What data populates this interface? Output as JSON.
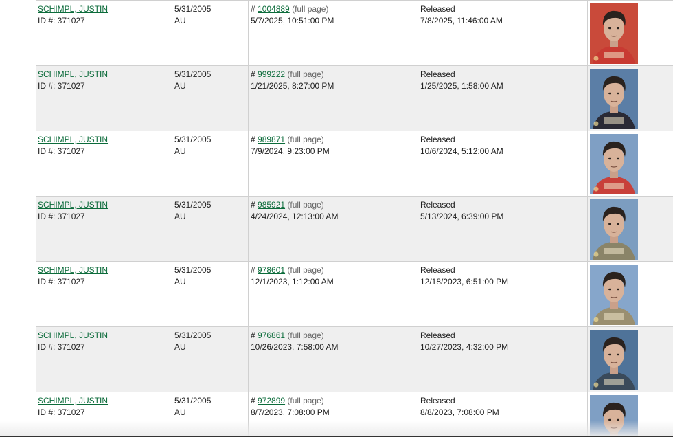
{
  "records": [
    {
      "name": "SCHIMPL, JUSTIN",
      "id_line": "ID #: 371027",
      "dob": "5/31/2005",
      "race_sex": "AU",
      "booking_prefix": "# ",
      "booking_number": "1004889",
      "full_page": "(full page)",
      "booking_date": "5/7/2025, 10:51:00 PM",
      "status": "Released",
      "release_date": "7/8/2025, 11:46:00 AM",
      "photo_bg": "#c94a3a",
      "photo_shirt": "#c83a32"
    },
    {
      "name": "SCHIMPL, JUSTIN",
      "id_line": "ID #: 371027",
      "dob": "5/31/2005",
      "race_sex": "AU",
      "booking_prefix": "# ",
      "booking_number": "999222",
      "full_page": "(full page)",
      "booking_date": "1/21/2025, 8:27:00 PM",
      "status": "Released",
      "release_date": "1/25/2025, 1:58:00 AM",
      "photo_bg": "#5b7ea6",
      "photo_shirt": "#2a2a35"
    },
    {
      "name": "SCHIMPL, JUSTIN",
      "id_line": "ID #: 371027",
      "dob": "5/31/2005",
      "race_sex": "AU",
      "booking_prefix": "# ",
      "booking_number": "989871",
      "full_page": "(full page)",
      "booking_date": "7/9/2024, 9:23:00 PM",
      "status": "Released",
      "release_date": "10/6/2024, 5:12:00 AM",
      "photo_bg": "#7f9fc4",
      "photo_shirt": "#c8403a"
    },
    {
      "name": "SCHIMPL, JUSTIN",
      "id_line": "ID #: 371027",
      "dob": "5/31/2005",
      "race_sex": "AU",
      "booking_prefix": "# ",
      "booking_number": "985921",
      "full_page": "(full page)",
      "booking_date": "4/24/2024, 12:13:00 AM",
      "status": "Released",
      "release_date": "5/13/2024, 6:39:00 PM",
      "photo_bg": "#7c9dc0",
      "photo_shirt": "#8a8468"
    },
    {
      "name": "SCHIMPL, JUSTIN",
      "id_line": "ID #: 371027",
      "dob": "5/31/2005",
      "race_sex": "AU",
      "booking_prefix": "# ",
      "booking_number": "978601",
      "full_page": "(full page)",
      "booking_date": "12/1/2023, 1:12:00 AM",
      "status": "Released",
      "release_date": "12/18/2023, 6:51:00 PM",
      "photo_bg": "#86a6cb",
      "photo_shirt": "#9a8f70"
    },
    {
      "name": "SCHIMPL, JUSTIN",
      "id_line": "ID #: 371027",
      "dob": "5/31/2005",
      "race_sex": "AU",
      "booking_prefix": "# ",
      "booking_number": "976861",
      "full_page": "(full page)",
      "booking_date": "10/26/2023, 7:58:00 AM",
      "status": "Released",
      "release_date": "10/27/2023, 4:32:00 PM",
      "photo_bg": "#4f7399",
      "photo_shirt": "#3a4a5a"
    },
    {
      "name": "SCHIMPL, JUSTIN",
      "id_line": "ID #: 371027",
      "dob": "5/31/2005",
      "race_sex": "AU",
      "booking_prefix": "# ",
      "booking_number": "972899",
      "full_page": "(full page)",
      "booking_date": "8/7/2023, 7:08:00 PM",
      "status": "Released",
      "release_date": "8/8/2023, 7:08:00 PM",
      "photo_bg": "#7f9fc4",
      "photo_shirt": "#c8403a"
    }
  ]
}
